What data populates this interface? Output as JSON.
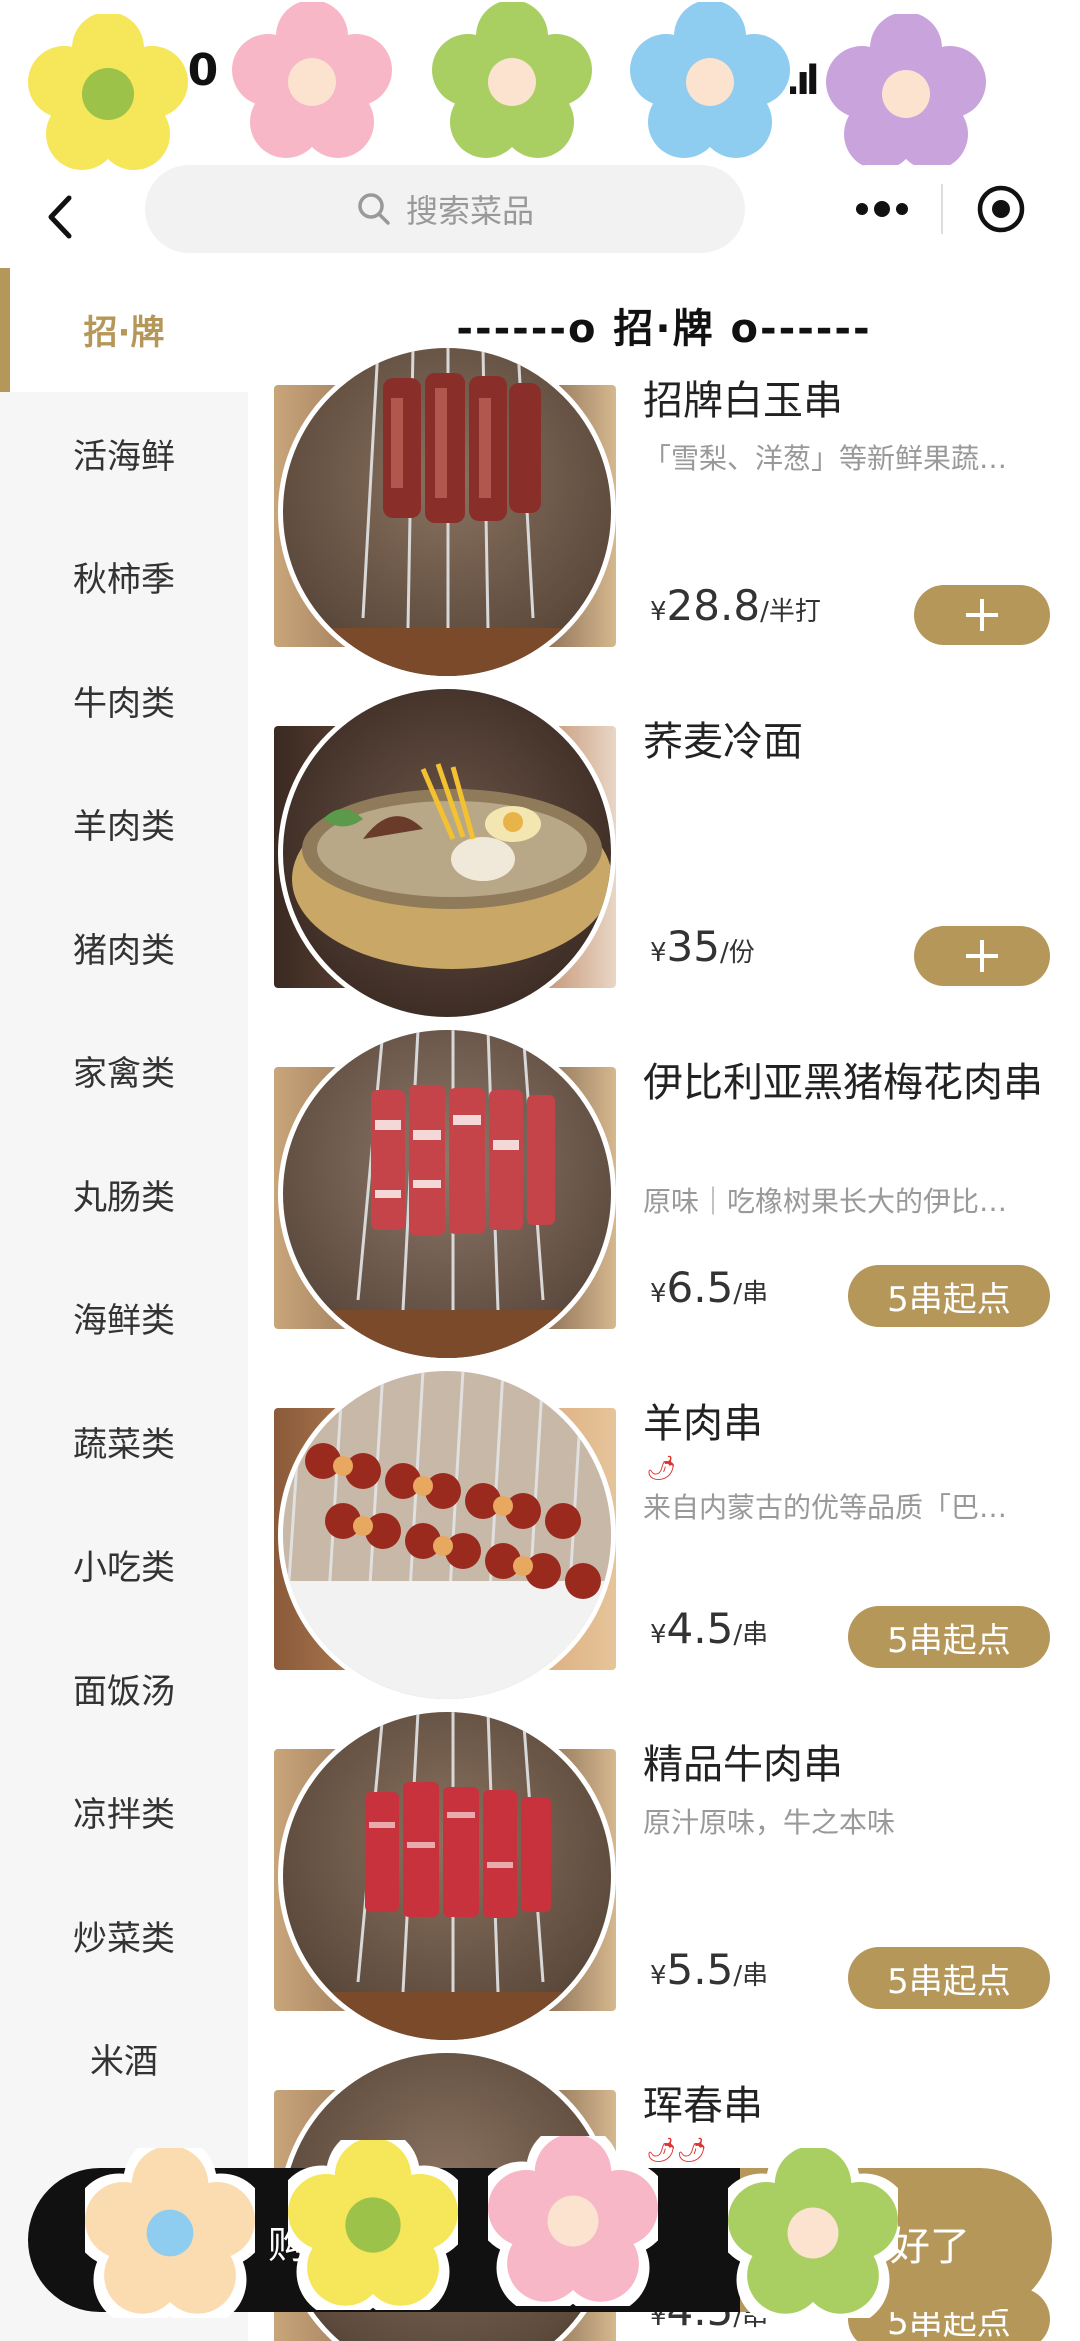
{
  "status_bar": {
    "time": ":0",
    "signal": ".ıl"
  },
  "nav": {
    "search_placeholder": "搜索菜品"
  },
  "sidebar": {
    "items": [
      {
        "label": "招·牌"
      },
      {
        "label": "活海鲜"
      },
      {
        "label": "秋柿季"
      },
      {
        "label": "牛肉类"
      },
      {
        "label": "羊肉类"
      },
      {
        "label": "猪肉类"
      },
      {
        "label": "家禽类"
      },
      {
        "label": "丸肠类"
      },
      {
        "label": "海鲜类"
      },
      {
        "label": "蔬菜类"
      },
      {
        "label": "小吃类"
      },
      {
        "label": "面饭汤"
      },
      {
        "label": "凉拌类"
      },
      {
        "label": "炒菜类"
      },
      {
        "label": "米酒"
      }
    ]
  },
  "main": {
    "section_title": "------o 招·牌 o------",
    "dishes": [
      {
        "name": "招牌白玉串",
        "desc": "「雪梨、洋葱」等新鲜果蔬…",
        "yen": "¥",
        "price": "28.8",
        "unit": "/半打",
        "action": "+"
      },
      {
        "name": "荞麦冷面",
        "desc": "",
        "yen": "¥",
        "price": "35",
        "unit": "/份",
        "action": "+"
      },
      {
        "name": "伊比利亚黑猪梅花肉串",
        "desc": "原味｜吃橡树果长大的伊比…",
        "yen": "¥",
        "price": "6.5",
        "unit": "/串",
        "action": "5串起点"
      },
      {
        "name": "羊肉串",
        "spicy": "🌶",
        "desc": "来自内蒙古的优等品质「巴…",
        "yen": "¥",
        "price": "4.5",
        "unit": "/串",
        "action": "5串起点"
      },
      {
        "name": "精品牛肉串",
        "desc": "原汁原味，牛之本味",
        "yen": "¥",
        "price": "5.5",
        "unit": "/串",
        "action": "5串起点"
      },
      {
        "name": "珲春串",
        "spicy": "🌶🌶",
        "desc": "",
        "yen": "¥",
        "price": "4.5",
        "unit": "/串",
        "action": "5串起点"
      }
    ]
  },
  "cart": {
    "left_text": "购 定如",
    "right_text": "好了"
  },
  "colors": {
    "accent": "#b5975a",
    "sidebar_bg": "#f6f6f6",
    "cart_dark": "#111111"
  }
}
